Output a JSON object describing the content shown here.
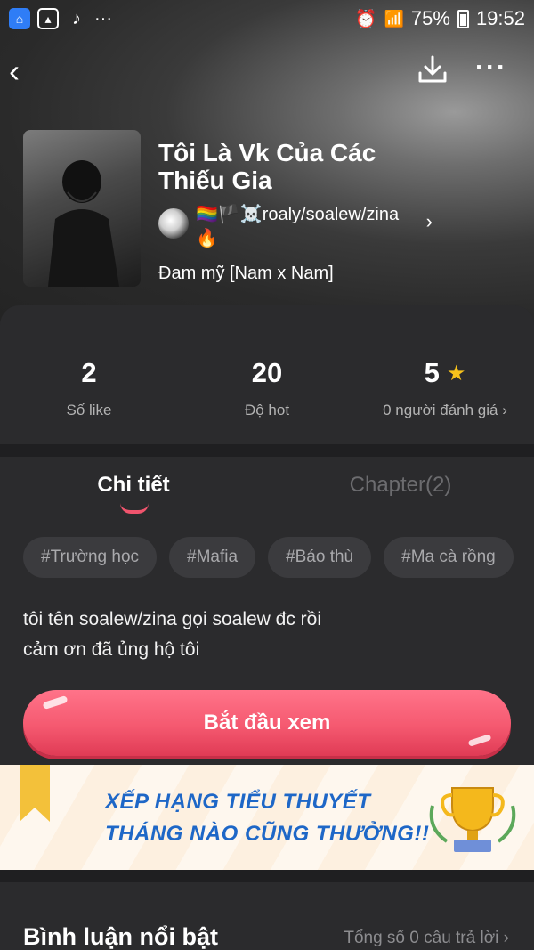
{
  "status_bar": {
    "dots": "···",
    "battery": "75%",
    "time": "19:52"
  },
  "nav": {
    "back": "‹",
    "more": "···"
  },
  "book": {
    "title": "Tôi Là Vk Của Các Thiếu Gia",
    "author": "🏳️‍🌈🏴☠️roaly/soalew/zina🔥",
    "author_chevron": "›",
    "genre": "Đam mỹ [Nam x Nam]"
  },
  "stats": {
    "likes": {
      "value": "2",
      "label": "Số like"
    },
    "hot": {
      "value": "20",
      "label": "Độ hot"
    },
    "rating": {
      "value": "5",
      "label": "0 người đánh giá ›"
    }
  },
  "tabs": {
    "detail": "Chi tiết",
    "chapters": "Chapter(2)"
  },
  "tags": [
    "#Trường học",
    "#Mafia",
    "#Báo thù",
    "#Ma cà rồng"
  ],
  "description": {
    "line1": "tôi tên soalew/zina gọi soalew đc rồi",
    "line2": "cảm ơn đã ủng hộ tôi"
  },
  "start_button": "Bắt đầu xem",
  "banner": {
    "line1": "XẾP HẠNG TIỂU THUYẾT",
    "line2": "THÁNG NÀO CŨNG THƯỞNG!!"
  },
  "comments": {
    "title": "Bình luận nổi bật",
    "count": "Tổng số 0 câu trả lời ›"
  },
  "colors": {
    "accent": "#f55970",
    "star": "#f7c21b",
    "banner_text": "#1e67c7"
  }
}
